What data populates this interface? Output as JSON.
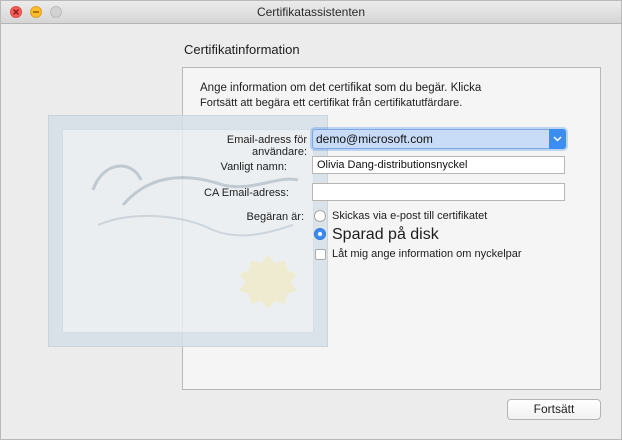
{
  "window": {
    "title": "Certifikatassistenten",
    "controls": [
      "close-icon",
      "minimize-icon",
      "zoom-icon"
    ]
  },
  "section": {
    "title": "Certifikatinformation",
    "intro_line1": "Ange information om det certifikat som du begär. Klicka",
    "intro_line2": "Fortsätt att begära ett certifikat från certifikatutfärdare."
  },
  "form": {
    "email_label": "Email-adress för användare:",
    "email_value": "demo@microsoft.com",
    "common_name_label": "Vanligt namn:",
    "common_name_value": "Olivia Dang-distributionsnyckel",
    "ca_email_label": "CA Email-adress:",
    "ca_email_value": "",
    "request_label": "Begäran är:",
    "options": [
      {
        "label": "Skickas via e-post till certifikatet",
        "selected": false
      },
      {
        "label": "Sparad på disk",
        "selected": true
      }
    ],
    "checkbox_label": "Låt mig ange information om nyckelpar",
    "checkbox_checked": false
  },
  "buttons": {
    "continue_label": "Fortsätt"
  },
  "colors": {
    "accent": "#3b8df2",
    "window_bg": "#ececec"
  }
}
